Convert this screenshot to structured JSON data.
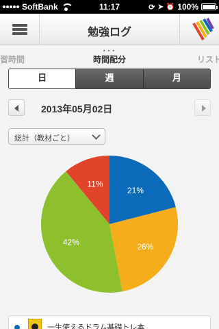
{
  "status_bar": {
    "carrier": "SoftBank",
    "time": "11:17",
    "battery": "100%"
  },
  "nav": {
    "title": "勉強ログ"
  },
  "pager": {
    "left": "学習時間",
    "center": "時間配分",
    "right": "リスト",
    "dots": "•••"
  },
  "segments": {
    "day": "日",
    "week": "週",
    "month": "月",
    "selected": "日"
  },
  "date": "2013年05月02日",
  "filter": {
    "selected": "総計（教材ごと）"
  },
  "colors": {
    "blue": "#0b6ab9",
    "orange": "#f5ad1b",
    "green": "#8ec02e",
    "red": "#e2432b"
  },
  "chart_data": {
    "type": "pie",
    "slices": [
      {
        "label": "21%",
        "value": 21,
        "color": "#0b6ab9"
      },
      {
        "label": "26%",
        "value": 26,
        "color": "#f5ad1b"
      },
      {
        "label": "42%",
        "value": 42,
        "color": "#8ec02e"
      },
      {
        "label": "11%",
        "value": 11,
        "color": "#e2432b"
      }
    ]
  },
  "list": [
    {
      "name": "一生使えるドラム基礎トレ本"
    }
  ]
}
